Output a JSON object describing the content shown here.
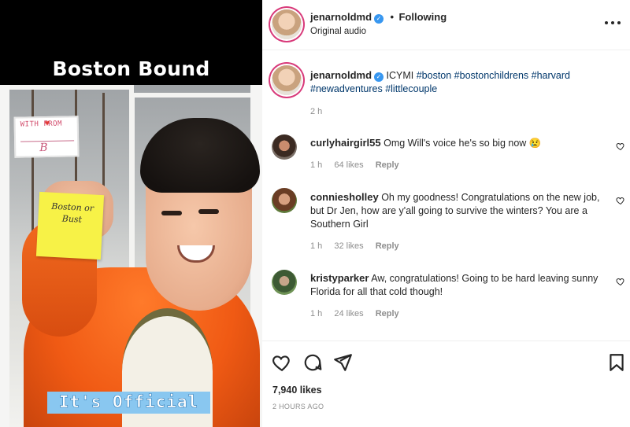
{
  "media": {
    "title": "Boston Bound",
    "sticker_text": "WITH   FROM",
    "sticker_letter": "B",
    "note_text": "Boston or Bust",
    "caption": "It's Official"
  },
  "header": {
    "username": "jenarnoldmd",
    "separator": "•",
    "follow_status": "Following",
    "audio": "Original audio"
  },
  "post": {
    "username": "jenarnoldmd",
    "caption_prefix": "ICYMI",
    "hashtags_line1": "#boston #bostonchildrens #harvard",
    "hashtags_line2": "#newadventures #littlecouple",
    "age": "2 h"
  },
  "comments": [
    {
      "username": "curlyhairgirl55",
      "text": "Omg Will's voice he's so big now 😢",
      "age": "1 h",
      "likes": "64 likes",
      "reply": "Reply"
    },
    {
      "username": "conniesholley",
      "text": "Oh my goodness! Congratulations on the new job, but Dr Jen, how are y'all going to survive the winters? You are a Southern Girl",
      "age": "1 h",
      "likes": "32 likes",
      "reply": "Reply"
    },
    {
      "username": "kristyparker",
      "text": "Aw, congratulations! Going to be hard leaving sunny Florida for all that cold though!",
      "age": "1 h",
      "likes": "24 likes",
      "reply": "Reply"
    }
  ],
  "footer": {
    "likes": "7,940 likes",
    "time": "2 HOURS AGO"
  },
  "colors": {
    "verified": "#3897f0",
    "link": "#00376b",
    "muted": "#8e8e8e",
    "story_ring": "#d83a7a"
  },
  "icons": [
    "heart-icon",
    "comment-icon",
    "share-icon",
    "bookmark-icon",
    "more-icon",
    "verified-icon"
  ]
}
